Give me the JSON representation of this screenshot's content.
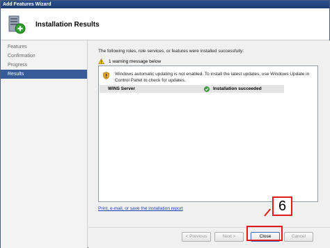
{
  "window": {
    "title": "Add Features Wizard"
  },
  "header": {
    "title": "Installation Results",
    "icon": "server-wizard-icon"
  },
  "sidebar": {
    "items": [
      {
        "label": "Features"
      },
      {
        "label": "Confirmation"
      },
      {
        "label": "Progress"
      },
      {
        "label": "Results",
        "selected": true
      }
    ]
  },
  "content": {
    "intro": "The following roles, role services, or features were installed successfully:",
    "warning_summary": "1 warning message below",
    "warning_message": "Windows automatic updating is not enabled. To install the latest updates, use Windows Update in Control Panel to check for updates.",
    "result": {
      "name": "WINS Server",
      "status": "Installation succeeded"
    },
    "report_link": "Print, e-mail, or save the installation report"
  },
  "buttons": {
    "previous": "< Previous",
    "next": "Next >",
    "close": "Close",
    "cancel": "Cancel"
  },
  "annotation": {
    "step": "6"
  },
  "colors": {
    "title_bar": "#1d3c72",
    "selected_nav": "#365b96",
    "highlight": "#e01a1a",
    "link": "#1a3fb0"
  }
}
